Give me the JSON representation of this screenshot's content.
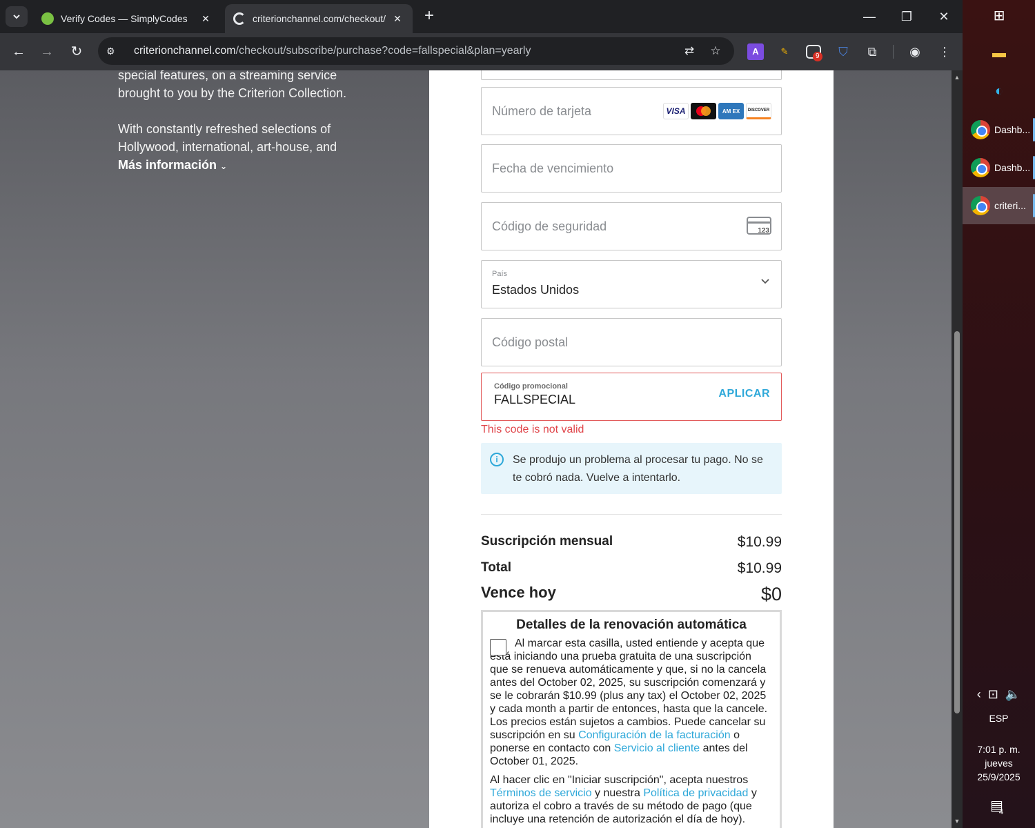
{
  "browser": {
    "tabs": [
      {
        "title": "Verify Codes — SimplyCodes",
        "active": false
      },
      {
        "title": "criterionchannel.com/checkout/",
        "active": true
      }
    ],
    "url_host": "criterionchannel.com",
    "url_path": "/checkout/subscribe/purchase?code=fallspecial&plan=yearly",
    "extension_badge": "9"
  },
  "intro": {
    "line1": "special features, on a streaming service brought to you by the Criterion Collection.",
    "line2": "With constantly refreshed selections of Hollywood, international, art-house, and",
    "more": "Más información"
  },
  "form": {
    "card_number_placeholder": "Número de tarjeta",
    "card_brands": [
      "VISA",
      "",
      "AM EX",
      "DISCOVER"
    ],
    "expiry_placeholder": "Fecha de vencimiento",
    "security_placeholder": "Código de seguridad",
    "security_icon_text": "123",
    "country_label": "País",
    "country_value": "Estados Unidos",
    "postal_placeholder": "Código postal",
    "promo_label": "Código promocional",
    "promo_value": "FALLSPECIAL",
    "promo_apply": "APLICAR",
    "promo_error": "This code is not valid",
    "notice": "Se produjo un problema al procesar tu pago. No se te cobró nada. Vuelve a intentarlo."
  },
  "summary": {
    "monthly_label": "Suscripción mensual",
    "monthly_value": "$10.99",
    "total_label": "Total",
    "total_value": "$10.99",
    "due_label": "Vence hoy",
    "due_value": "$0"
  },
  "renewal": {
    "title": "Detalles de la renovación automática",
    "text_a": "Al marcar esta casilla, usted entiende y acepta que está iniciando una prueba gratuita de una suscripción que se renueva automáticamente y que, si no la cancela antes del October 02, 2025, su suscripción comenzará y se le cobrarán $10.99 (plus any tax) el October 02, 2025 y cada month a partir de entonces, hasta que la cancele. Los precios están sujetos a cambios. Puede cancelar su suscripción en su ",
    "link_billing": "Configuración de la facturación",
    "text_b": " o ponerse en contacto con ",
    "link_support": "Servicio al cliente",
    "text_c": " antes del October 01, 2025.",
    "terms_a": "Al hacer clic en \"Iniciar suscripción\", acepta nuestros ",
    "link_terms": "Términos de servicio",
    "terms_b": " y nuestra ",
    "link_privacy": "Política de privacidad",
    "terms_c": " y autoriza el cobro a través de su método de pago (que incluye una retención de autorización el día de hoy)."
  },
  "taskbar": {
    "items": [
      "Dashb...",
      "Dashb...",
      "criteri..."
    ],
    "language": "ESP",
    "time": "7:01 p. m.",
    "day": "jueves",
    "date": "25/9/2025",
    "notifications": "4"
  },
  "colors": {
    "accent": "#2ea8d9",
    "error": "#e0454a",
    "notice_bg": "#e7f5fb"
  }
}
